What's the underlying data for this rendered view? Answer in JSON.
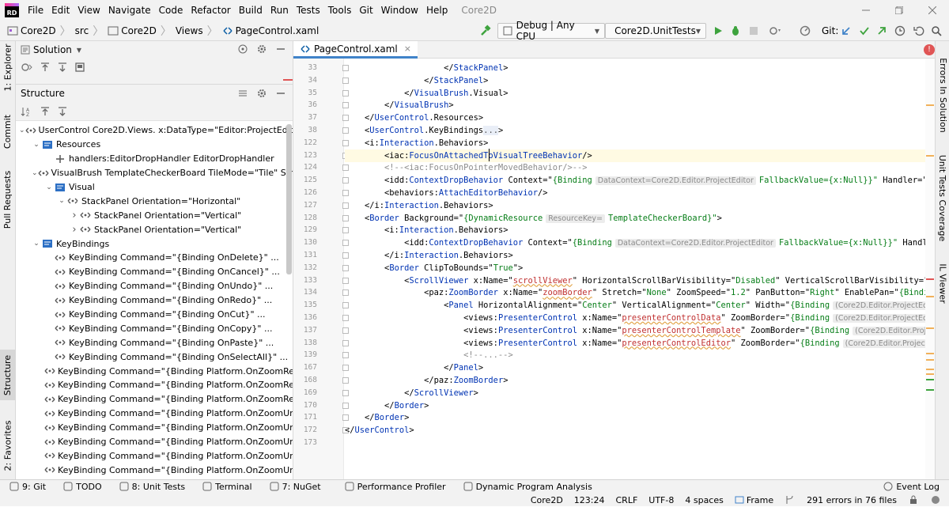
{
  "app": {
    "title": "Core2D",
    "logo": "RD"
  },
  "menu": [
    "File",
    "Edit",
    "View",
    "Navigate",
    "Code",
    "Refactor",
    "Build",
    "Run",
    "Tests",
    "Tools",
    "Git",
    "Window",
    "Help"
  ],
  "breadcrumb": [
    "Core2D",
    "src",
    "Core2D",
    "Views",
    "PageControl.xaml"
  ],
  "toolbar": {
    "config": "Debug | Any CPU",
    "project": "Core2D.UnitTests",
    "git_label": "Git:"
  },
  "left_tabs": [
    "1: Explorer",
    "Commit",
    "Pull Requests",
    "Structure",
    "2: Favorites"
  ],
  "right_tabs": [
    "Errors In Solution",
    "Unit Tests Coverage",
    "IL Viewer"
  ],
  "solution": {
    "title": "Solution"
  },
  "structure": {
    "title": "Structure",
    "rows": [
      {
        "depth": 0,
        "arrow": "down",
        "icon": "xaml-element-icon",
        "text": "UserControl Core2D.Views.  x:DataType=\"Editor:ProjectEditor\" ..."
      },
      {
        "depth": 1,
        "arrow": "down",
        "icon": "resources-icon",
        "text": "Resources"
      },
      {
        "depth": 2,
        "arrow": "",
        "icon": "handler-icon",
        "text": "handlers:EditorDropHandler EditorDropHandler"
      },
      {
        "depth": 1,
        "arrow": "down",
        "icon": "xaml-element-icon",
        "text": "VisualBrush TemplateCheckerBoard  TileMode=\"Tile\" Stretch="
      },
      {
        "depth": 2,
        "arrow": "down",
        "icon": "resources-icon",
        "text": "Visual"
      },
      {
        "depth": 3,
        "arrow": "down",
        "icon": "xaml-element-icon",
        "text": "StackPanel  Orientation=\"Horizontal\""
      },
      {
        "depth": 4,
        "arrow": "right",
        "icon": "xaml-element-icon",
        "text": "StackPanel  Orientation=\"Vertical\""
      },
      {
        "depth": 4,
        "arrow": "right",
        "icon": "xaml-element-icon",
        "text": "StackPanel  Orientation=\"Vertical\""
      },
      {
        "depth": 1,
        "arrow": "down",
        "icon": "resources-icon",
        "text": "KeyBindings"
      },
      {
        "depth": 2,
        "arrow": "",
        "icon": "xaml-element-icon",
        "text": "KeyBinding  Command=\"{Binding OnDelete}\" ..."
      },
      {
        "depth": 2,
        "arrow": "",
        "icon": "xaml-element-icon",
        "text": "KeyBinding  Command=\"{Binding OnCancel}\" ..."
      },
      {
        "depth": 2,
        "arrow": "",
        "icon": "xaml-element-icon",
        "text": "KeyBinding  Command=\"{Binding OnUndo}\" ..."
      },
      {
        "depth": 2,
        "arrow": "",
        "icon": "xaml-element-icon",
        "text": "KeyBinding  Command=\"{Binding OnRedo}\" ..."
      },
      {
        "depth": 2,
        "arrow": "",
        "icon": "xaml-element-icon",
        "text": "KeyBinding  Command=\"{Binding OnCut}\" ..."
      },
      {
        "depth": 2,
        "arrow": "",
        "icon": "xaml-element-icon",
        "text": "KeyBinding  Command=\"{Binding OnCopy}\" ..."
      },
      {
        "depth": 2,
        "arrow": "",
        "icon": "xaml-element-icon",
        "text": "KeyBinding  Command=\"{Binding OnPaste}\" ..."
      },
      {
        "depth": 2,
        "arrow": "",
        "icon": "xaml-element-icon",
        "text": "KeyBinding  Command=\"{Binding OnSelectAll}\" ..."
      },
      {
        "depth": 2,
        "arrow": "",
        "icon": "xaml-element-icon",
        "text": "KeyBinding  Command=\"{Binding Platform.OnZoomReset}\" ..."
      },
      {
        "depth": 2,
        "arrow": "",
        "icon": "xaml-element-icon",
        "text": "KeyBinding  Command=\"{Binding Platform.OnZoomReset}\" ..."
      },
      {
        "depth": 2,
        "arrow": "",
        "icon": "xaml-element-icon",
        "text": "KeyBinding  Command=\"{Binding Platform.OnZoomReset}\" ..."
      },
      {
        "depth": 2,
        "arrow": "",
        "icon": "xaml-element-icon",
        "text": "KeyBinding  Command=\"{Binding Platform.OnZoomUniform"
      },
      {
        "depth": 2,
        "arrow": "",
        "icon": "xaml-element-icon",
        "text": "KeyBinding  Command=\"{Binding Platform.OnZoomUniform"
      },
      {
        "depth": 2,
        "arrow": "",
        "icon": "xaml-element-icon",
        "text": "KeyBinding  Command=\"{Binding Platform.OnZoomUniform"
      },
      {
        "depth": 2,
        "arrow": "",
        "icon": "xaml-element-icon",
        "text": "KeyBinding  Command=\"{Binding Platform.OnZoomUniform"
      },
      {
        "depth": 2,
        "arrow": "",
        "icon": "xaml-element-icon",
        "text": "KeyBinding  Command=\"{Binding Platform.OnZoomUniform"
      },
      {
        "depth": 2,
        "arrow": "",
        "icon": "xaml-element-icon",
        "text": "KeyBinding  Command=\"{Binding Platform.OnZoomFill}\""
      }
    ]
  },
  "editor": {
    "tab": "PageControl.xaml",
    "lines": [
      {
        "n": "33",
        "parts": [
          [
            "t",
            "                    </"
          ],
          [
            "tag",
            "StackPanel"
          ],
          [
            "t",
            ">"
          ]
        ]
      },
      {
        "n": "34",
        "parts": [
          [
            "t",
            "                </"
          ],
          [
            "tag",
            "StackPanel"
          ],
          [
            "t",
            ">"
          ]
        ]
      },
      {
        "n": "35",
        "parts": [
          [
            "t",
            "            </"
          ],
          [
            "tag",
            "VisualBrush"
          ],
          [
            "t",
            ".Visual>"
          ]
        ]
      },
      {
        "n": "36",
        "parts": [
          [
            "t",
            "        </"
          ],
          [
            "tag",
            "VisualBrush"
          ],
          [
            "t",
            ">"
          ]
        ]
      },
      {
        "n": "37",
        "parts": [
          [
            "t",
            "    </"
          ],
          [
            "tag",
            "UserControl"
          ],
          [
            "t",
            ".Resources>"
          ]
        ]
      },
      {
        "n": "38",
        "parts": [
          [
            "t",
            "    <"
          ],
          [
            "tag",
            "UserControl"
          ],
          [
            "t",
            ".KeyBindings"
          ],
          [
            "fold",
            "..."
          ],
          [
            "t",
            ">"
          ]
        ]
      },
      {
        "n": "122",
        "parts": [
          [
            "t",
            "    <i:"
          ],
          [
            "tag",
            "Interaction"
          ],
          [
            "t",
            ".Behaviors>"
          ]
        ]
      },
      {
        "n": "123",
        "hl": true,
        "parts": [
          [
            "t",
            "        <iac:"
          ],
          [
            "tag",
            "FocusOnAttachedToVisualTreeBehavior"
          ],
          [
            "t",
            "/>"
          ]
        ]
      },
      {
        "n": "124",
        "parts": [
          [
            "cm",
            "        <!--<iac:FocusOnPointerMovedBehavior/>-->"
          ]
        ]
      },
      {
        "n": "125",
        "parts": [
          [
            "t",
            "        <idd:"
          ],
          [
            "tag",
            "ContextDropBehavior"
          ],
          [
            "t",
            " Context=\""
          ],
          [
            "val",
            "{Binding"
          ],
          [
            "hint",
            "DataContext=Core2D.Editor.ProjectEditor"
          ],
          [
            "val",
            "FallbackValue={x:Null}}\""
          ],
          [
            "t",
            " Handler=\"{"
          ]
        ]
      },
      {
        "n": "126",
        "parts": [
          [
            "t",
            "        <behaviors:"
          ],
          [
            "tag",
            "AttachEditorBehavior"
          ],
          [
            "t",
            "/>"
          ]
        ]
      },
      {
        "n": "127",
        "parts": [
          [
            "t",
            "    </i:"
          ],
          [
            "tag",
            "Interaction"
          ],
          [
            "t",
            ".Behaviors>"
          ]
        ]
      },
      {
        "n": "128",
        "parts": [
          [
            "t",
            "    <"
          ],
          [
            "tag",
            "Border"
          ],
          [
            "t",
            " Background=\""
          ],
          [
            "val",
            "{DynamicResource"
          ],
          [
            "hint",
            "ResourceKey="
          ],
          [
            "val",
            "TemplateCheckerBoard}\""
          ],
          [
            "t",
            ">"
          ]
        ]
      },
      {
        "n": "129",
        "parts": [
          [
            "t",
            "        <i:"
          ],
          [
            "tag",
            "Interaction"
          ],
          [
            "t",
            ".Behaviors>"
          ]
        ]
      },
      {
        "n": "130",
        "parts": [
          [
            "t",
            "            <idd:"
          ],
          [
            "tag",
            "ContextDropBehavior"
          ],
          [
            "t",
            " Context=\""
          ],
          [
            "val",
            "{Binding"
          ],
          [
            "hint",
            "DataContext=Core2D.Editor.ProjectEditor"
          ],
          [
            "val",
            "FallbackValue={x:Null}}\""
          ],
          [
            "t",
            " Handler="
          ]
        ]
      },
      {
        "n": "131",
        "parts": [
          [
            "t",
            "        </i:"
          ],
          [
            "tag",
            "Interaction"
          ],
          [
            "t",
            ".Behaviors>"
          ]
        ]
      },
      {
        "n": "132",
        "parts": [
          [
            "t",
            "        <"
          ],
          [
            "tag",
            "Border"
          ],
          [
            "t",
            " ClipToBounds=\""
          ],
          [
            "val",
            "True"
          ],
          [
            "t",
            "\">"
          ]
        ]
      },
      {
        "n": "133",
        "parts": [
          [
            "t",
            "            <"
          ],
          [
            "tag",
            "ScrollViewer"
          ],
          [
            "t",
            " x:Name=\""
          ],
          [
            "str",
            "scrollViewer"
          ],
          [
            "t",
            "\" HorizontalScrollBarVisibility=\""
          ],
          [
            "val",
            "Disabled"
          ],
          [
            "t",
            "\" VerticalScrollBarVisibility=\"Dis"
          ]
        ]
      },
      {
        "n": "134",
        "parts": [
          [
            "t",
            "                <paz:"
          ],
          [
            "tag",
            "ZoomBorder"
          ],
          [
            "t",
            " x:Name=\""
          ],
          [
            "str",
            "zoomBorder"
          ],
          [
            "t",
            "\" Stretch=\""
          ],
          [
            "val",
            "None"
          ],
          [
            "t",
            "\" ZoomSpeed=\""
          ],
          [
            "val",
            "1.2"
          ],
          [
            "t",
            "\" PanButton=\""
          ],
          [
            "val",
            "Right"
          ],
          [
            "t",
            "\" EnablePan=\""
          ],
          [
            "val",
            "{Binding"
          ]
        ]
      },
      {
        "n": "135",
        "parts": [
          [
            "t",
            "                    <"
          ],
          [
            "tag",
            "Panel"
          ],
          [
            "t",
            " HorizontalAlignment=\""
          ],
          [
            "val",
            "Center"
          ],
          [
            "t",
            "\" VerticalAlignment=\""
          ],
          [
            "val",
            "Center"
          ],
          [
            "t",
            "\" Width=\""
          ],
          [
            "val",
            "{Binding"
          ],
          [
            "hint",
            "(Core2D.Editor.ProjectEditor"
          ]
        ]
      },
      {
        "n": "136",
        "parts": [
          [
            "t",
            "                        <views:"
          ],
          [
            "tag",
            "PresenterControl"
          ],
          [
            "t",
            " x:Name=\""
          ],
          [
            "str",
            "presenterControlData"
          ],
          [
            "t",
            "\" ZoomBorder=\""
          ],
          [
            "val",
            "{Binding"
          ],
          [
            "hint",
            "(Core2D.Editor.ProjectEditor"
          ]
        ]
      },
      {
        "n": "137",
        "parts": [
          [
            "t",
            "                        <views:"
          ],
          [
            "tag",
            "PresenterControl"
          ],
          [
            "t",
            " x:Name=\""
          ],
          [
            "str",
            "presenterControlTemplate"
          ],
          [
            "t",
            "\" ZoomBorder=\""
          ],
          [
            "val",
            "{Binding"
          ],
          [
            "hint",
            "(Core2D.Editor.ProjectEditor"
          ]
        ]
      },
      {
        "n": "138",
        "parts": [
          [
            "t",
            "                        <views:"
          ],
          [
            "tag",
            "PresenterControl"
          ],
          [
            "t",
            " x:Name=\""
          ],
          [
            "str",
            "presenterControlEditor"
          ],
          [
            "t",
            "\" ZoomBorder=\""
          ],
          [
            "val",
            "{Binding"
          ],
          [
            "hint",
            "(Core2D.Editor.ProjectEditor"
          ]
        ]
      },
      {
        "n": "139",
        "parts": [
          [
            "cm",
            "                        <!--...-->"
          ]
        ]
      },
      {
        "n": "167",
        "parts": [
          [
            "t",
            "                    </"
          ],
          [
            "tag",
            "Panel"
          ],
          [
            "t",
            ">"
          ]
        ]
      },
      {
        "n": "168",
        "parts": [
          [
            "t",
            "                </paz:"
          ],
          [
            "tag",
            "ZoomBorder"
          ],
          [
            "t",
            ">"
          ]
        ]
      },
      {
        "n": "169",
        "parts": [
          [
            "t",
            "            </"
          ],
          [
            "tag",
            "ScrollViewer"
          ],
          [
            "t",
            ">"
          ]
        ]
      },
      {
        "n": "170",
        "parts": [
          [
            "t",
            "        </"
          ],
          [
            "tag",
            "Border"
          ],
          [
            "t",
            ">"
          ]
        ]
      },
      {
        "n": "171",
        "parts": [
          [
            "t",
            "    </"
          ],
          [
            "tag",
            "Border"
          ],
          [
            "t",
            ">"
          ]
        ]
      },
      {
        "n": "172",
        "parts": [
          [
            "t",
            "</"
          ],
          [
            "tag",
            "UserControl"
          ],
          [
            "t",
            ">"
          ]
        ]
      },
      {
        "n": "173",
        "parts": []
      }
    ]
  },
  "bottom_tabs": [
    "9: Git",
    "TODO",
    "8: Unit Tests",
    "Terminal",
    "7: NuGet",
    "Performance Profiler",
    "Dynamic Program Analysis"
  ],
  "status": {
    "event_log": "Event Log",
    "project": "Core2D",
    "position": "123:24",
    "line_ending": "CRLF",
    "encoding": "UTF-8",
    "indent": "4 spaces",
    "frame": "Frame",
    "errors": "291 errors in 76 files"
  },
  "colors": {
    "tag": "#0033b3",
    "attr_value": "#067d17",
    "string": "#c03030",
    "comment": "#8c8c8c",
    "accent": "#4083c9",
    "run": "#3ea33e"
  }
}
